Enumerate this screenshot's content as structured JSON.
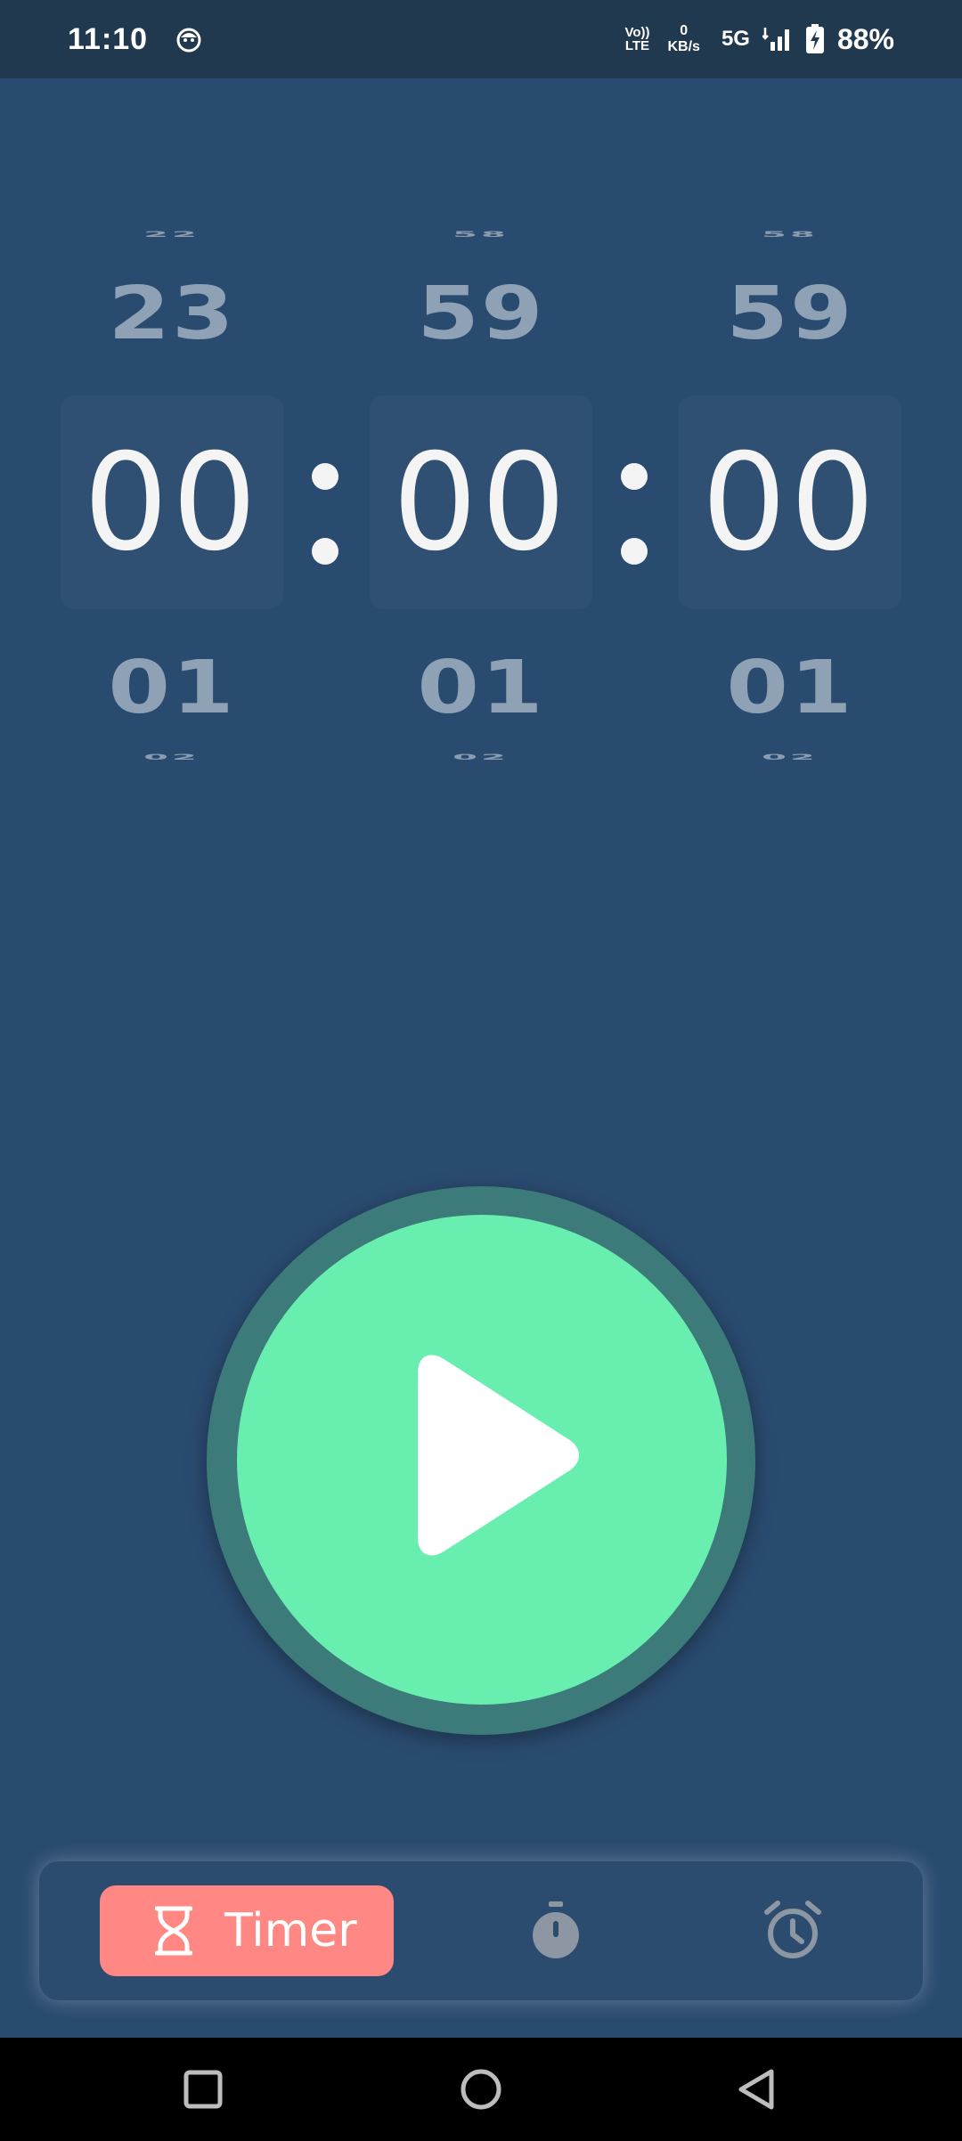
{
  "status_bar": {
    "time": "11:10",
    "volte_top": "Vo))",
    "volte_bottom": "LTE",
    "netspeed_value": "0",
    "netspeed_unit": "KB/s",
    "network": "5G",
    "battery": "88%",
    "icons": [
      "app-notification-icon",
      "signal-icon",
      "battery-charging-icon"
    ]
  },
  "picker": {
    "hours": {
      "far_above": "22",
      "above": "23",
      "selected": "00",
      "below": "01",
      "far_below": "02"
    },
    "minutes": {
      "far_above": "58",
      "above": "59",
      "selected": "00",
      "below": "01",
      "far_below": "02"
    },
    "seconds": {
      "far_above": "58",
      "above": "59",
      "selected": "00",
      "below": "01",
      "far_below": "02"
    }
  },
  "play_button": {
    "icon": "play-icon",
    "color": "#68efb0",
    "ring_color": "#3c7b7a"
  },
  "tabs": {
    "timer_label": "Timer",
    "items": [
      "hourglass-icon",
      "stopwatch-icon",
      "alarm-clock-icon"
    ],
    "active_color": "#ff8784"
  },
  "nav": {
    "icons": [
      "recents-icon",
      "home-icon",
      "back-icon"
    ]
  },
  "colors": {
    "background": "#2a4b70",
    "status_bar": "#21394f"
  }
}
